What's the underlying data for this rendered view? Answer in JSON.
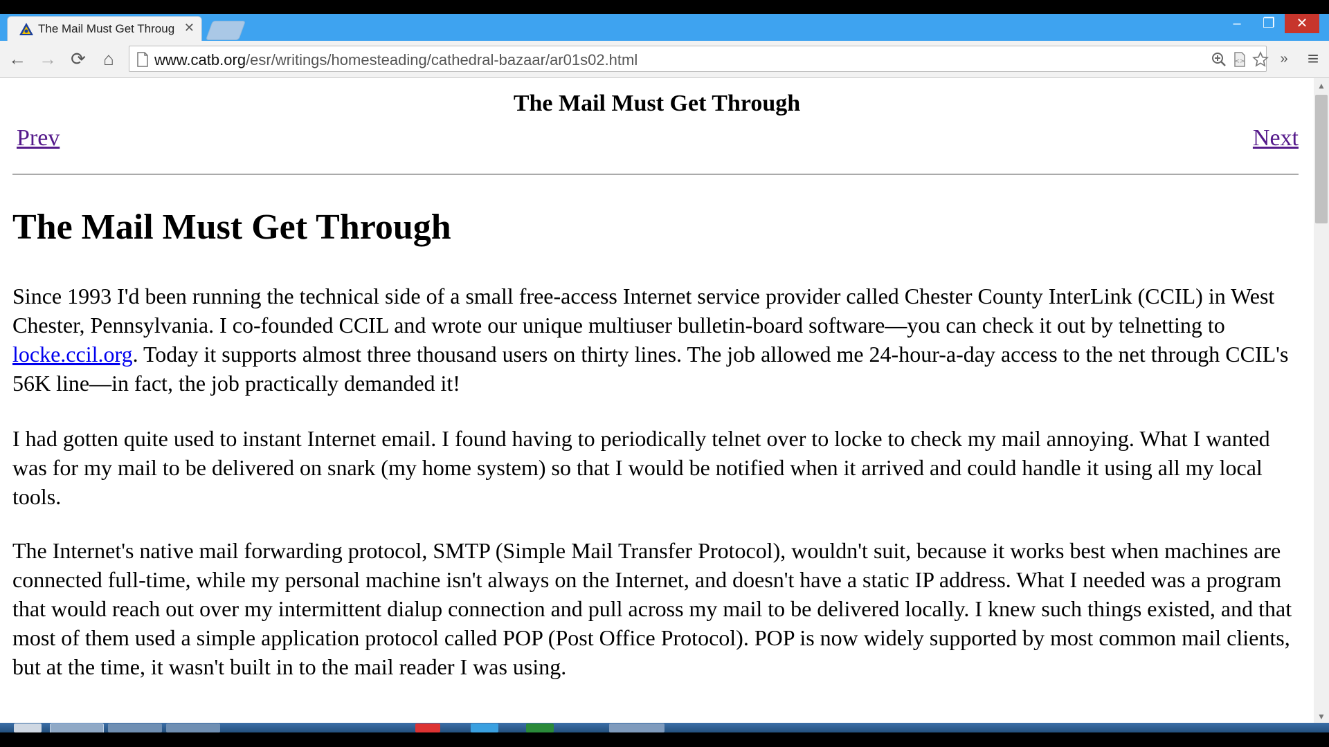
{
  "browser": {
    "tab_title": "The Mail Must Get Throug",
    "tab_close": "✕",
    "window_controls": {
      "minimize": "‒",
      "maximize": "❐",
      "close": "✕"
    },
    "toolbar": {
      "back": "←",
      "forward": "→",
      "reload": "⟳",
      "home": "⌂",
      "url_host": "www.catb.org",
      "url_path": "/esr/writings/homesteading/cathedral-bazaar/ar01s02.html",
      "overflow": "»",
      "menu": "≡"
    },
    "accent_color": "#3ea3f0"
  },
  "page": {
    "nav_title": "The Mail Must Get Through",
    "prev_label": "Prev",
    "next_label": "Next",
    "heading": "The Mail Must Get Through",
    "paragraph1_before_link": "Since 1993 I'd been running the technical side of a small free-access Internet service provider called Chester County InterLink (CCIL) in West Chester, Pennsylvania. I co-founded CCIL and wrote our unique multiuser bulletin-board software—you can check it out by telnetting to ",
    "paragraph1_link": "locke.ccil.org",
    "paragraph1_after_link": ". Today it supports almost three thousand users on thirty lines. The job allowed me 24-hour-a-day access to the net through CCIL's 56K line—in fact, the job practically demanded it!",
    "paragraph2": "I had gotten quite used to instant Internet email. I found having to periodically telnet over to locke to check my mail annoying. What I wanted was for my mail to be delivered on snark (my home system) so that I would be notified when it arrived and could handle it using all my local tools.",
    "paragraph3": "The Internet's native mail forwarding protocol, SMTP (Simple Mail Transfer Protocol), wouldn't suit, because it works best when machines are connected full-time, while my personal machine isn't always on the Internet, and doesn't have a static IP address. What I needed was a program that would reach out over my intermittent dialup connection and pull across my mail to be delivered locally. I knew such things existed, and that most of them used a simple application protocol called POP (Post Office Protocol). POP is now widely supported by most common mail clients, but at the time, it wasn't built in to the mail reader I was using."
  }
}
